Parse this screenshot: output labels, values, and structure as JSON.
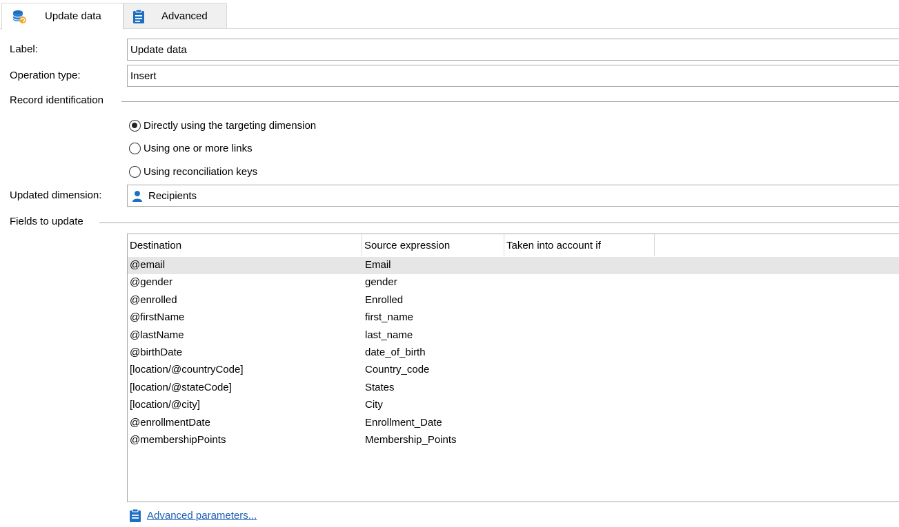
{
  "tabs": [
    {
      "label": "Update data",
      "icon": "database-refresh-icon"
    },
    {
      "label": "Advanced",
      "icon": "clipboard-icon"
    }
  ],
  "form": {
    "label_label": "Label:",
    "label_value": "Update data",
    "operation_label": "Operation type:",
    "operation_value": "Insert",
    "record_identification": "Record identification",
    "radios": [
      {
        "label": "Directly using the targeting dimension",
        "checked": true
      },
      {
        "label": "Using one or more links",
        "checked": false
      },
      {
        "label": "Using reconciliation keys",
        "checked": false
      }
    ],
    "updated_dimension_label": "Updated dimension:",
    "updated_dimension_value": "Recipients",
    "fields_to_update": "Fields to update"
  },
  "table": {
    "headers": [
      "Destination",
      "Source expression",
      "Taken into account if"
    ],
    "rows": [
      {
        "destination": "@email",
        "source": "Email",
        "condition": ""
      },
      {
        "destination": "@gender",
        "source": "gender",
        "condition": ""
      },
      {
        "destination": "@enrolled",
        "source": "Enrolled",
        "condition": ""
      },
      {
        "destination": "@firstName",
        "source": "first_name",
        "condition": ""
      },
      {
        "destination": "@lastName",
        "source": "last_name",
        "condition": ""
      },
      {
        "destination": "@birthDate",
        "source": "date_of_birth",
        "condition": ""
      },
      {
        "destination": "[location/@countryCode]",
        "source": "Country_code",
        "condition": ""
      },
      {
        "destination": "[location/@stateCode]",
        "source": "States",
        "condition": ""
      },
      {
        "destination": "[location/@city]",
        "source": "City",
        "condition": ""
      },
      {
        "destination": "@enrollmentDate",
        "source": "Enrollment_Date",
        "condition": ""
      },
      {
        "destination": "@membershipPoints",
        "source": "Membership_Points",
        "condition": ""
      }
    ]
  },
  "advanced_link": "Advanced parameters...",
  "colors": {
    "link": "#1a5fb4",
    "icon_blue": "#1d6fc4",
    "selected_row": "#e6e6e6"
  }
}
